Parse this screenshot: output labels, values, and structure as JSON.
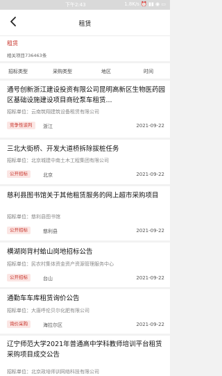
{
  "status": {
    "time": "下午2:43",
    "net": "1.8K/s ⏰ ▮▮ ◉ ▭"
  },
  "nav": {
    "title": "租赁"
  },
  "summary": {
    "keyword": "租赁",
    "count": "相关项目736463条"
  },
  "filters": [
    "招标类型",
    "采购类型",
    "地区",
    "时间"
  ],
  "unit_label": "招标单位：",
  "items": [
    {
      "title": "通号创新浙江建设投资有限公司昆明高新区生物医药园区基础设施建设项目商砼泵车租赁...",
      "unit": "云南筑翔建筑设备租赁有限公司",
      "badge": "竞争性谈判",
      "region": "浙江",
      "date": "2021-09-22"
    },
    {
      "title": "三北大街桥、开发大道桥拆除拔桩任务",
      "unit": "北京城建中南土木工程集团有限公司",
      "badge": "公开招标",
      "region": "北京",
      "date": "2021-09-22"
    },
    {
      "title": "慈利县图书馆关于其他租赁服务的网上超市采购项目",
      "unit": "慈利县图书馆",
      "badge": "公开招标",
      "region": "慈利县",
      "date": "2021-09-22"
    },
    {
      "title": "横湖岗背村蛤山岗地招标公告",
      "unit": "民农村集体资金资产资源管理服务中心",
      "badge": "公开招标",
      "region": "台山",
      "date": "2021-09-22"
    },
    {
      "title": "通勤车车库租赁询价公告",
      "unit": "大唐呼伦贝尔化肥有限公司",
      "badge": "询价采购",
      "region": "海拉尔区",
      "date": "2021-09-22"
    },
    {
      "title": "辽宁师范大学2021年普通高中学科教师培训平台租赁采购项目成交公告",
      "unit": "北京政培师训网络科技有限公司",
      "badge": "",
      "region": "",
      "date": ""
    }
  ]
}
